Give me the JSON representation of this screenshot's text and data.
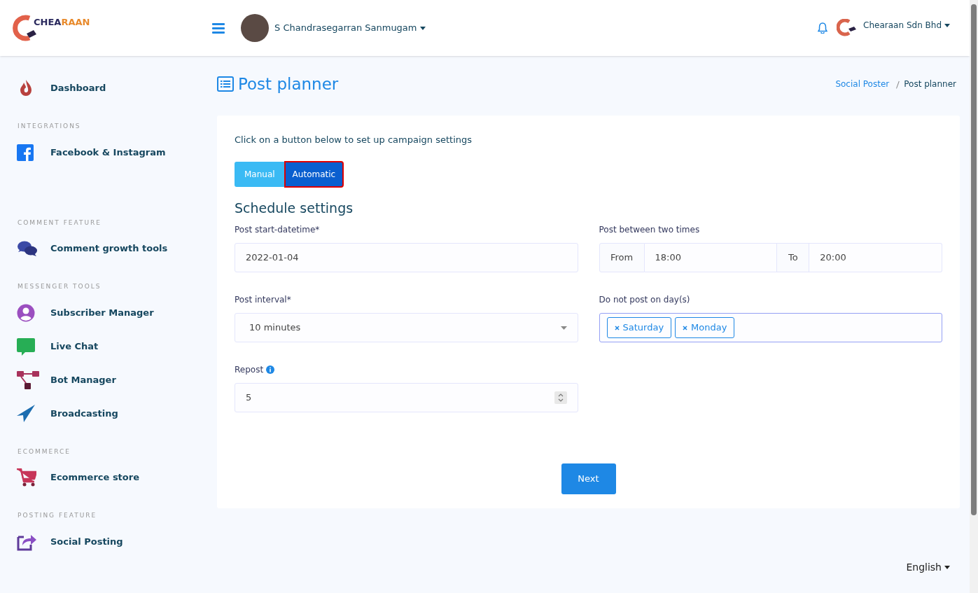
{
  "header": {
    "logo_text": {
      "dark": "CHEA",
      "accent": "RAAN"
    },
    "user_name": "S Chandrasegarran Sanmugam",
    "company_name": "Chearaan Sdn Bhd"
  },
  "sidebar": {
    "sections": [
      {
        "items": [
          {
            "label": "Dashboard"
          }
        ]
      },
      {
        "heading": "INTEGRATIONS",
        "items": [
          {
            "label": "Facebook & Instagram"
          }
        ]
      },
      {
        "heading": "COMMENT FEATURE",
        "items": [
          {
            "label": "Comment growth tools"
          }
        ]
      },
      {
        "heading": "MESSENGER TOOLS",
        "items": [
          {
            "label": "Subscriber Manager"
          },
          {
            "label": "Live Chat"
          },
          {
            "label": "Bot Manager"
          },
          {
            "label": "Broadcasting"
          }
        ]
      },
      {
        "heading": "ECOMMERCE",
        "items": [
          {
            "label": "Ecommerce store"
          }
        ]
      },
      {
        "heading": "POSTING FEATURE",
        "items": [
          {
            "label": "Social Posting"
          }
        ]
      }
    ]
  },
  "page": {
    "title": "Post planner",
    "breadcrumb": [
      {
        "label": "Social Poster",
        "link": true
      },
      {
        "label": "Post planner",
        "link": false
      }
    ]
  },
  "card": {
    "intro": "Click on a button below to set up campaign settings",
    "modes": [
      {
        "label": "Manual",
        "selected": false
      },
      {
        "label": "Automatic",
        "selected": true
      }
    ],
    "section_title": "Schedule settings",
    "start_datetime": {
      "label": "Post start-datetime*",
      "value": "2022-01-04"
    },
    "time_range": {
      "label": "Post between two times",
      "from_label": "From",
      "from_value": "18:00",
      "to_label": "To",
      "to_value": "20:00"
    },
    "interval": {
      "label": "Post interval*",
      "value": "10 minutes"
    },
    "excluded_days": {
      "label": "Do not post on day(s)",
      "tags": [
        "Saturday",
        "Monday"
      ]
    },
    "repost": {
      "label": "Repost",
      "value": "5"
    },
    "next_button": "Next"
  },
  "language": "English"
}
